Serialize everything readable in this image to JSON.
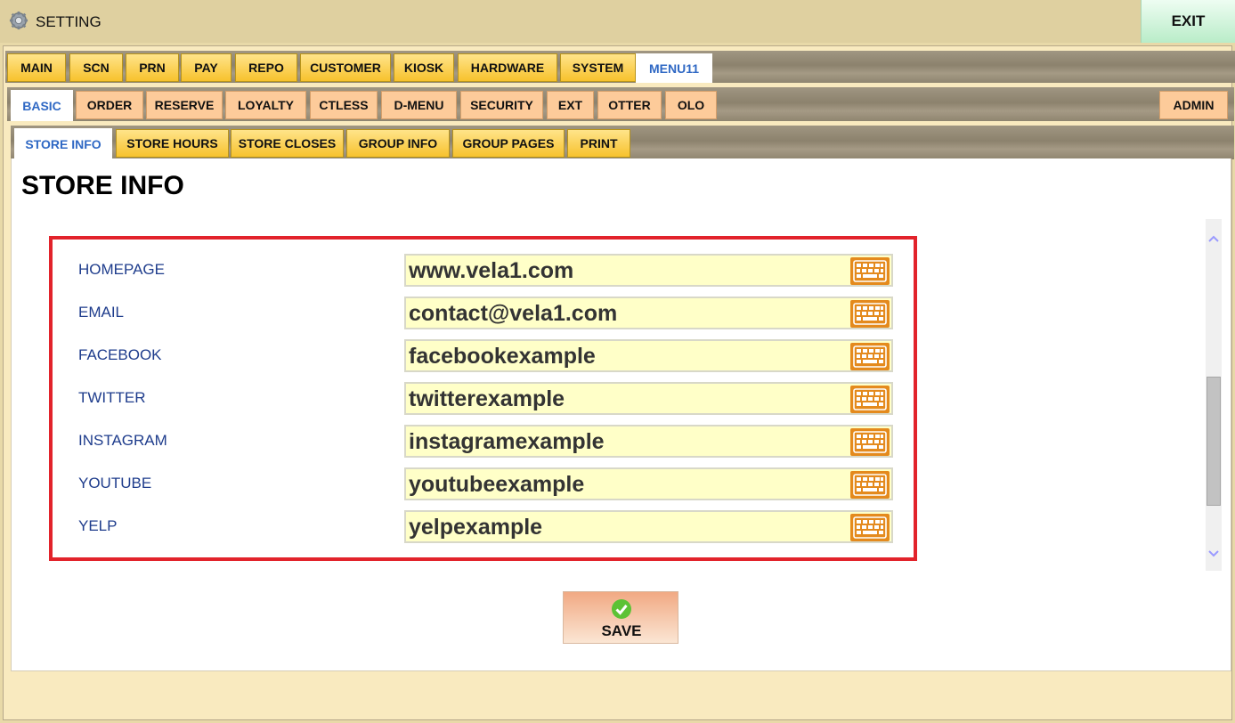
{
  "app": {
    "title": "SETTING",
    "exit_label": "EXIT"
  },
  "tabs_level1": [
    "MAIN",
    "SCN",
    "PRN",
    "PAY",
    "REPO",
    "CUSTOMER",
    "KIOSK",
    "HARDWARE",
    "SYSTEM",
    "MENU11"
  ],
  "tabs_level1_active": "MENU11",
  "tabs_level2": [
    "BASIC",
    "ORDER",
    "RESERVE",
    "LOYALTY",
    "CTLESS",
    "D-MENU",
    "SECURITY",
    "EXT",
    "OTTER",
    "OLO",
    "ADMIN"
  ],
  "tabs_level2_active": "BASIC",
  "tabs_level3": [
    "STORE INFO",
    "STORE HOURS",
    "STORE CLOSES",
    "GROUP INFO",
    "GROUP PAGES",
    "PRINT"
  ],
  "tabs_level3_active": "STORE INFO",
  "page": {
    "title": "STORE INFO"
  },
  "form": {
    "rows": [
      {
        "label": "HOMEPAGE",
        "value": "www.vela1.com"
      },
      {
        "label": "EMAIL",
        "value": "contact@vela1.com"
      },
      {
        "label": "FACEBOOK",
        "value": "facebookexample"
      },
      {
        "label": "TWITTER",
        "value": "twitterexample"
      },
      {
        "label": "INSTAGRAM",
        "value": "instagramexample"
      },
      {
        "label": "YOUTUBE",
        "value": "youtubeexample"
      },
      {
        "label": "YELP",
        "value": "yelpexample"
      }
    ]
  },
  "save": {
    "label": "SAVE"
  },
  "icons": {
    "title": "gear-icon",
    "field_button": "keyboard-icon",
    "save": "check-icon"
  },
  "colors": {
    "accent": "#2f68c4",
    "highlight_border": "#e2232b",
    "field_bg": "#ffffc8",
    "keyboard_button": "#e48a1d"
  }
}
